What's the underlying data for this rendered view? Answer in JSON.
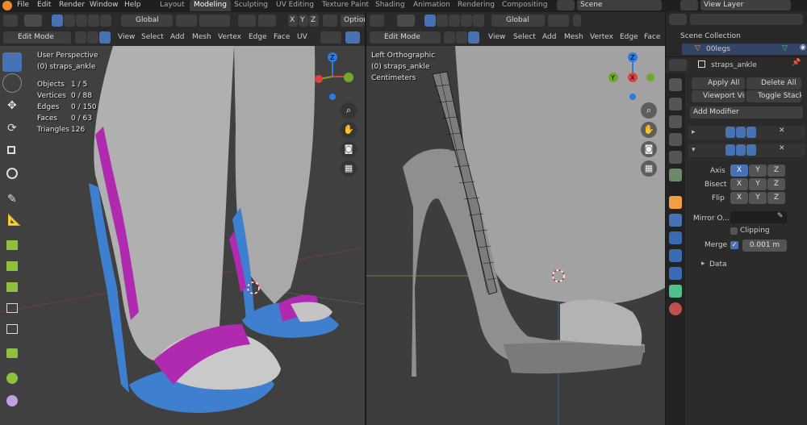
{
  "menu": {
    "file": "File",
    "edit": "Edit",
    "render": "Render",
    "window": "Window",
    "help": "Help"
  },
  "workspaces": [
    "Layout",
    "Modeling",
    "Sculpting",
    "UV Editing",
    "Texture Paint",
    "Shading",
    "Animation",
    "Rendering",
    "Compositing"
  ],
  "scene_name": "Scene",
  "view_layer": "View Layer",
  "left_view": {
    "orientation": "Global",
    "option_label": "Option",
    "mode": "Edit Mode",
    "menus": [
      "View",
      "Select",
      "Add",
      "Mesh",
      "Vertex",
      "Edge",
      "Face",
      "UV"
    ],
    "info_title": "User Perspective",
    "info_object": "(0) straps_ankle",
    "stats": [
      {
        "label": "Objects",
        "value": "1 / 5"
      },
      {
        "label": "Vertices",
        "value": "0 / 88"
      },
      {
        "label": "Edges",
        "value": "0 / 150"
      },
      {
        "label": "Faces",
        "value": "0 / 63"
      },
      {
        "label": "Triangles",
        "value": "126"
      }
    ],
    "gizmo": {
      "x": "X",
      "y": "Y",
      "z": "Z"
    }
  },
  "right_view": {
    "orientation": "Global",
    "mode": "Edit Mode",
    "menus": [
      "View",
      "Select",
      "Add",
      "Mesh",
      "Vertex",
      "Edge",
      "Face"
    ],
    "info_title": "Left Orthographic",
    "info_object": "(0) straps_ankle",
    "info_units": "Centimeters",
    "gizmo": {
      "x": "X",
      "y": "Y",
      "z": "Z"
    }
  },
  "outliner": {
    "root": "Scene Collection",
    "item": "00legs"
  },
  "properties": {
    "object_name": "straps_ankle",
    "apply_all": "Apply All",
    "delete_all": "Delete All",
    "viewport_vis": "Viewport Vis",
    "toggle_stack": "Toggle Stack",
    "add_modifier": "Add Modifier",
    "axis_label": "Axis",
    "bisect_label": "Bisect",
    "flip_label": "Flip",
    "axis_buttons": [
      "X",
      "Y",
      "Z"
    ],
    "mirror_object_label": "Mirror O...",
    "clipping_label": "Clipping",
    "merge_label": "Merge",
    "merge_value": "0.001 m",
    "data_label": "Data"
  },
  "colors": {
    "accent": "#4772b3",
    "viewport_bg": "#3d3d3d",
    "mesh_grey": "#9a9a9a",
    "strap_magenta": "#b02ab0",
    "shoe_blue": "#3f7fd0",
    "axis_x": "#e0413f",
    "axis_y": "#6ea82a",
    "axis_z": "#2b7be4"
  }
}
